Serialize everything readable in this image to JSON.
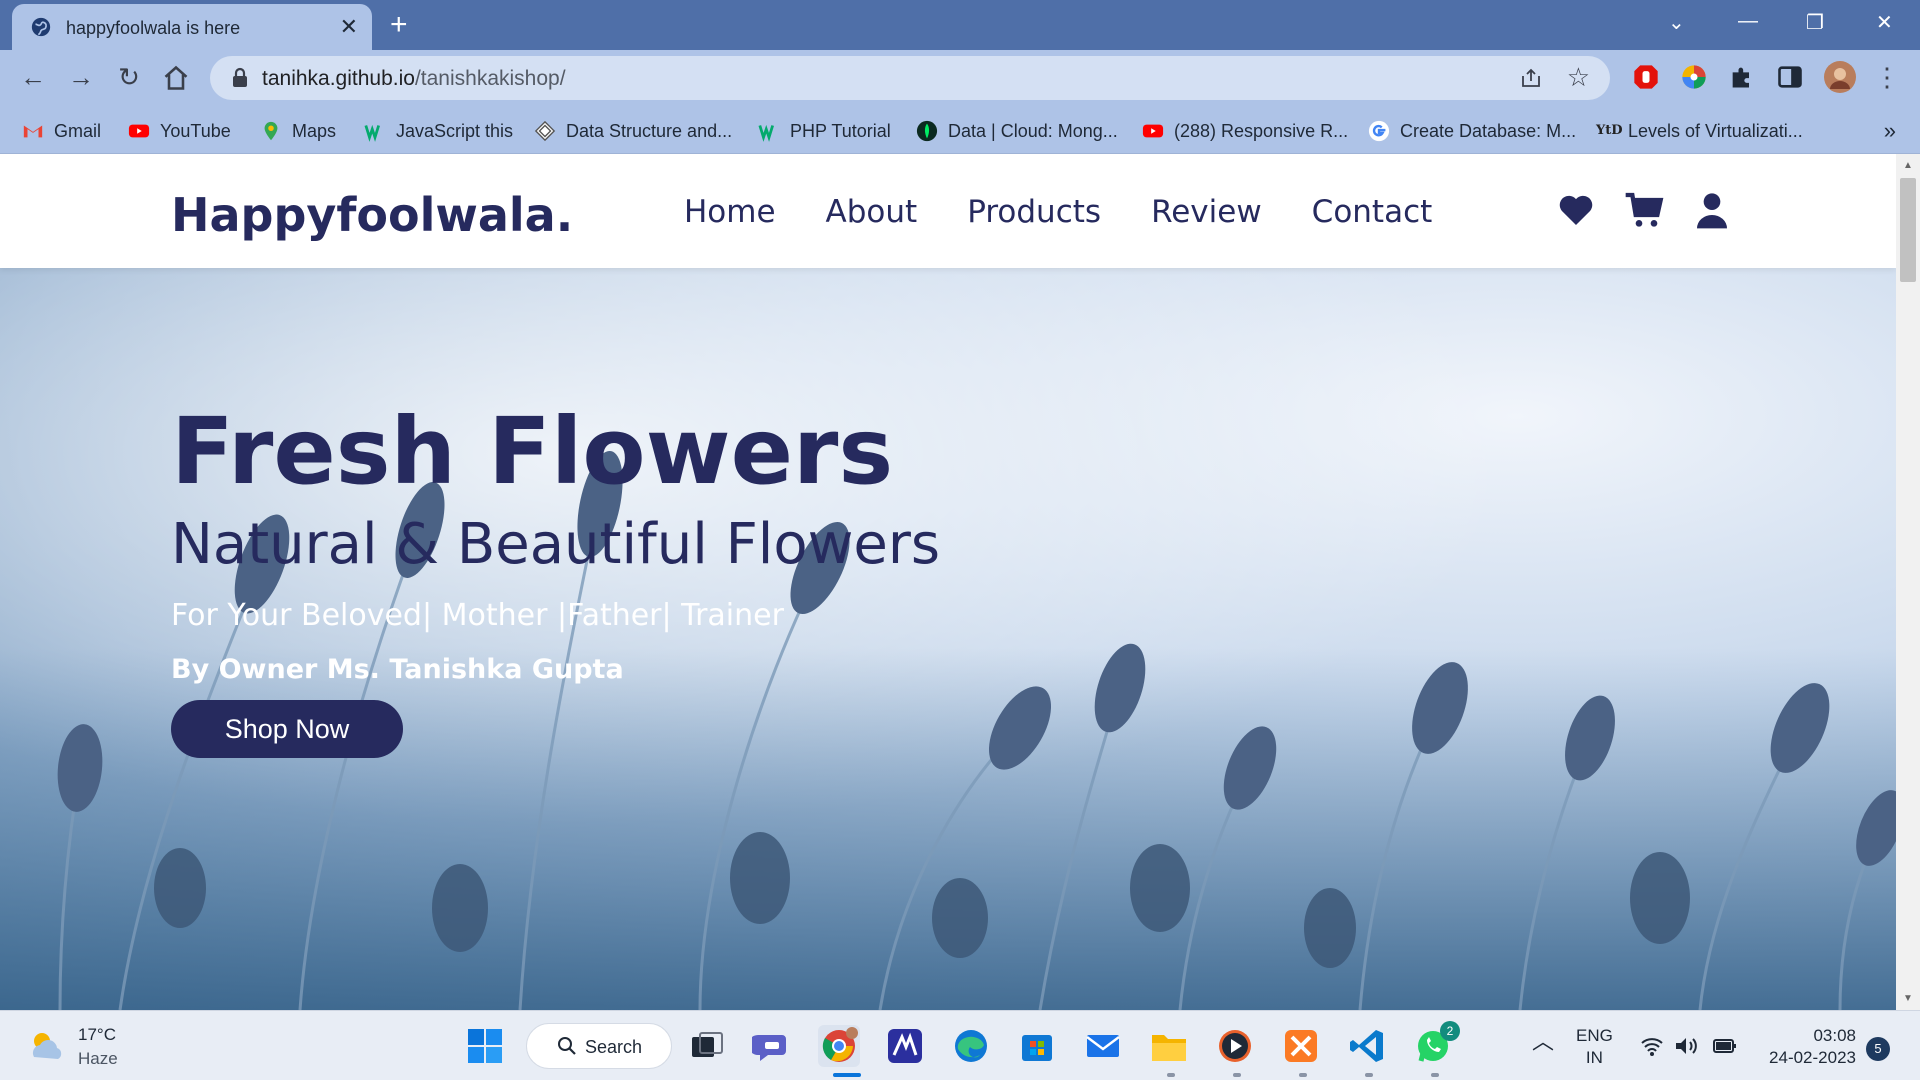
{
  "browser": {
    "tab_title": "happyfoolwala is here",
    "tab_close": "✕",
    "new_tab": "+",
    "url_host": "tanihka.github.io",
    "url_path": "/tanishkakishop/",
    "bookmarks": [
      {
        "label": "Gmail",
        "icon": "gmail-icon",
        "color": "#ea4335"
      },
      {
        "label": "YouTube",
        "icon": "youtube-icon",
        "color": "#ff0000"
      },
      {
        "label": "Maps",
        "icon": "maps-icon",
        "color": "#34a853"
      },
      {
        "label": "JavaScript this",
        "icon": "w3schools-icon",
        "color": "#04aa6d"
      },
      {
        "label": "Data Structure and...",
        "icon": "diamond-icon",
        "color": "#555555"
      },
      {
        "label": "PHP Tutorial",
        "icon": "w3schools-icon",
        "color": "#04aa6d"
      },
      {
        "label": "Data | Cloud: Mong...",
        "icon": "mongodb-icon",
        "color": "#00ed64"
      },
      {
        "label": "(288) Responsive R...",
        "icon": "youtube-icon",
        "color": "#ff0000"
      },
      {
        "label": "Create Database: M...",
        "icon": "google-icon",
        "color": "#4285f4"
      },
      {
        "label": "Levels of Virtualizati...",
        "icon": "yid-icon",
        "color": "#222222"
      }
    ],
    "bookmarks_more": "»"
  },
  "site": {
    "logo": "Happyfoolwala.",
    "nav": [
      "Home",
      "About",
      "Products",
      "Review",
      "Contact"
    ],
    "icons": [
      "heart-icon",
      "cart-icon",
      "user-icon"
    ],
    "brand_color": "#262a5e"
  },
  "hero": {
    "title": "Fresh Flowers",
    "subtitle": "Natural & Beautiful Flowers",
    "tagline": "For Your Beloved| Mother |Father| Trainer",
    "owner": "By Owner Ms. Tanishka Gupta",
    "cta": "Shop Now"
  },
  "taskbar": {
    "temperature": "17°C",
    "condition": "Haze",
    "search_label": "Search",
    "whatsapp_badge": "2",
    "lang_primary": "ENG",
    "lang_secondary": "IN",
    "time": "03:08",
    "date": "24-02-2023",
    "notification_count": "5"
  }
}
